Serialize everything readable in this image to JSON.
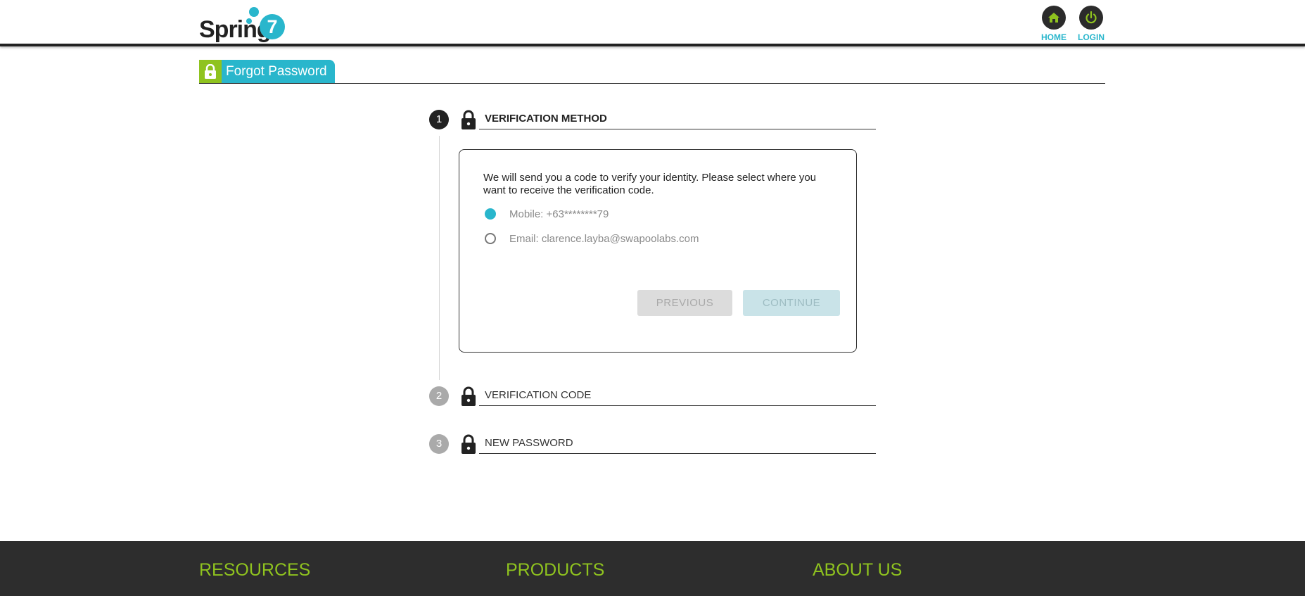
{
  "header": {
    "logo_text": "Spring",
    "logo_number": "7",
    "nav": [
      {
        "label": "HOME",
        "icon": "home-icon"
      },
      {
        "label": "LOGIN",
        "icon": "power-icon"
      }
    ]
  },
  "page_tab": {
    "label": "Forgot Password",
    "icon": "lock-icon"
  },
  "steps": [
    {
      "number": "1",
      "title": "VERIFICATION METHOD",
      "state": "active"
    },
    {
      "number": "2",
      "title": "VERIFICATION CODE",
      "state": "inactive"
    },
    {
      "number": "3",
      "title": "NEW PASSWORD",
      "state": "inactive"
    }
  ],
  "verification": {
    "description": "We will send you a code to verify your identity. Please select where you want to receive the verification code.",
    "options": [
      {
        "label": "Mobile: +63********79",
        "selected": true
      },
      {
        "label": "Email: clarence.layba@swapoolabs.com",
        "selected": false
      }
    ],
    "previous_label": "PREVIOUS",
    "continue_label": "CONTINUE"
  },
  "footer": {
    "columns": [
      "RESOURCES",
      "PRODUCTS",
      "ABOUT US"
    ]
  },
  "colors": {
    "accent": "#29b6cc",
    "brand_green": "#8fc31f",
    "dark": "#222222"
  }
}
